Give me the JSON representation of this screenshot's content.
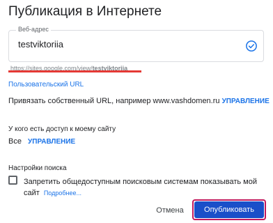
{
  "dialog": {
    "title": "Публикация в Интернете"
  },
  "web_address": {
    "label": "Веб-адрес",
    "value": "testviktoriia",
    "status_icon": "check-circle-icon",
    "url_prefix": "https://sites.google.com/view/",
    "url_slug": "testviktoriia"
  },
  "custom_url": {
    "heading": "Пользовательский URL",
    "text": "Привязать собственный URL, например www.vashdomen.ru",
    "manage_label": "УПРАВЛЕНИЕ"
  },
  "access": {
    "heading": "У кого есть доступ к моему сайту",
    "value": "Все",
    "manage_label": "УПРАВЛЕНИЕ"
  },
  "search": {
    "heading": "Настройки поиска",
    "checkbox_label": "Запретить общедоступным поисковым системам показывать мой сайт",
    "checked": false,
    "more_label": "Подробнее..."
  },
  "actions": {
    "cancel_label": "Отмена",
    "publish_label": "Опубликовать"
  },
  "colors": {
    "accent": "#1a73e8",
    "primary_button": "#1a4fc9",
    "highlight": "#e53935"
  }
}
